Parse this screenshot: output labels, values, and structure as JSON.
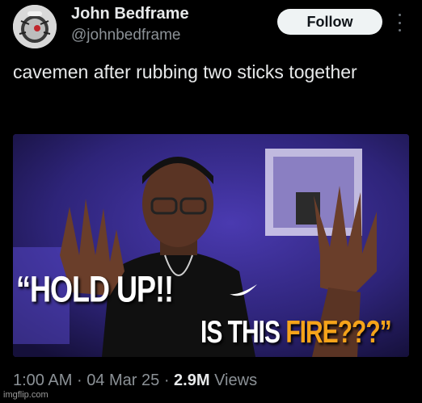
{
  "author": {
    "name": "John Bedframe",
    "handle": "@johnbedframe",
    "avatar_icon": "avatar-icon"
  },
  "actions": {
    "follow_label": "Follow",
    "more_icon": "more-vertical-icon"
  },
  "tweet": {
    "text": "cavemen after rubbing two sticks together"
  },
  "media": {
    "caption_line1": "“HOLD UP!!",
    "caption_line2_prefix": "IS THIS ",
    "caption_line2_highlight": "FIRE???”"
  },
  "meta": {
    "time": "1:00 AM",
    "separator": "·",
    "date": "04 Mar 25",
    "views_count": "2.9M",
    "views_label": "Views"
  },
  "watermark": "imgflip.com",
  "colors": {
    "background": "#000000",
    "text_primary": "#e7e9ea",
    "text_secondary": "#8b9196",
    "follow_bg": "#eff3f4",
    "fire_accent": "#f5a31a",
    "media_purple": "#3a2c8a"
  }
}
